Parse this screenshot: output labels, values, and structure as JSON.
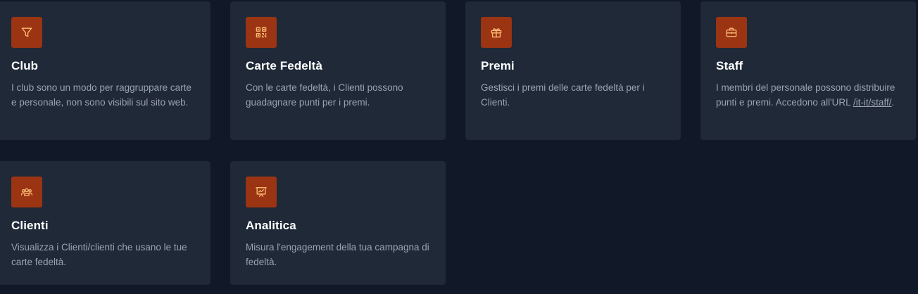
{
  "cards": [
    {
      "title": "Club",
      "icon": "filter-icon",
      "description": "I club sono un modo per raggruppare carte e personale, non sono visibili sul sito web."
    },
    {
      "title": "Carte Fedeltà",
      "icon": "qr-code-icon",
      "description": "Con le carte fedeltà, i Clienti possono guadagnare punti per i premi."
    },
    {
      "title": "Premi",
      "icon": "gift-icon",
      "description": "Gestisci i premi delle carte fedeltà per i Clienti."
    },
    {
      "title": "Staff",
      "icon": "briefcase-icon",
      "description_prefix": "I membri del personale possono distribuire punti e premi. Accedono all'URL ",
      "link_text": "/it-it/staff/",
      "description_suffix": "."
    },
    {
      "title": "Clienti",
      "icon": "users-icon",
      "description": "Visualizza i Clienti/clienti che usano le tue carte fedeltà."
    },
    {
      "title": "Analitica",
      "icon": "presentation-chart-icon",
      "description": "Misura l'engagement della tua campagna di fedeltà."
    }
  ],
  "colors": {
    "background": "#111827",
    "card": "#1f2937",
    "icon_bg": "#9a3412",
    "icon_stroke": "#fdba74",
    "title": "#ffffff",
    "text": "#9ca3af"
  }
}
